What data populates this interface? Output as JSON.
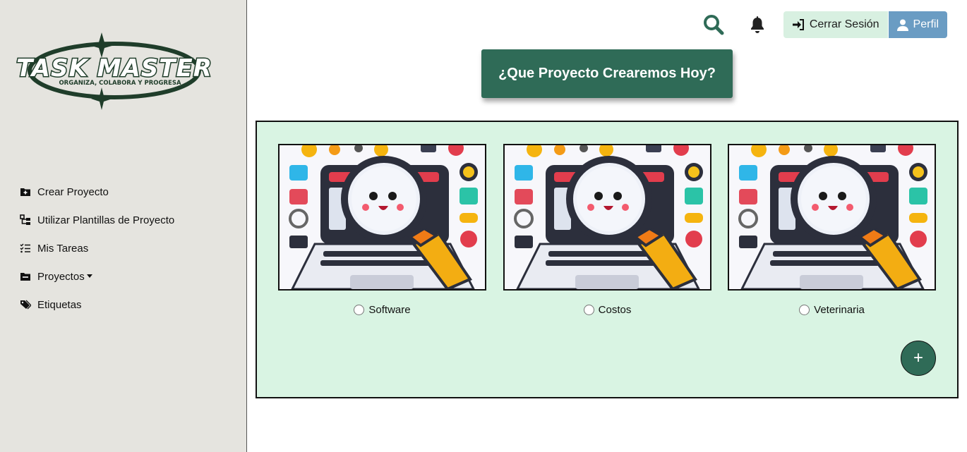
{
  "brand": {
    "logo_title": "TASK MASTER",
    "logo_tagline": "ORGANIZA, COLABORA Y PROGRESA",
    "colors": {
      "primary": "#2f6b57",
      "panel": "#d9f4e3",
      "sidebar": "#e5e4df",
      "profile": "#6a9cc3"
    }
  },
  "sidebar": {
    "items": [
      {
        "label": "Crear Proyecto",
        "icon": "folder-plus-icon"
      },
      {
        "label": "Utilizar Plantillas de Proyecto",
        "icon": "sitemap-icon"
      },
      {
        "label": "Mis Tareas",
        "icon": "list-check-icon"
      },
      {
        "label": "Proyectos",
        "icon": "folder-icon",
        "has_dropdown": true
      },
      {
        "label": "Etiquetas",
        "icon": "tags-icon"
      }
    ]
  },
  "header": {
    "search_icon": "search-icon",
    "notifications_icon": "bell-icon",
    "logout_label": "Cerrar Sesión",
    "profile_label": "Perfil"
  },
  "main": {
    "headline": "¿Que Proyecto Crearemos Hoy?",
    "templates": [
      {
        "label": "Software",
        "selected": false
      },
      {
        "label": "Costos",
        "selected": false
      },
      {
        "label": "Veterinaria",
        "selected": false
      }
    ],
    "add_button_label": "+"
  }
}
